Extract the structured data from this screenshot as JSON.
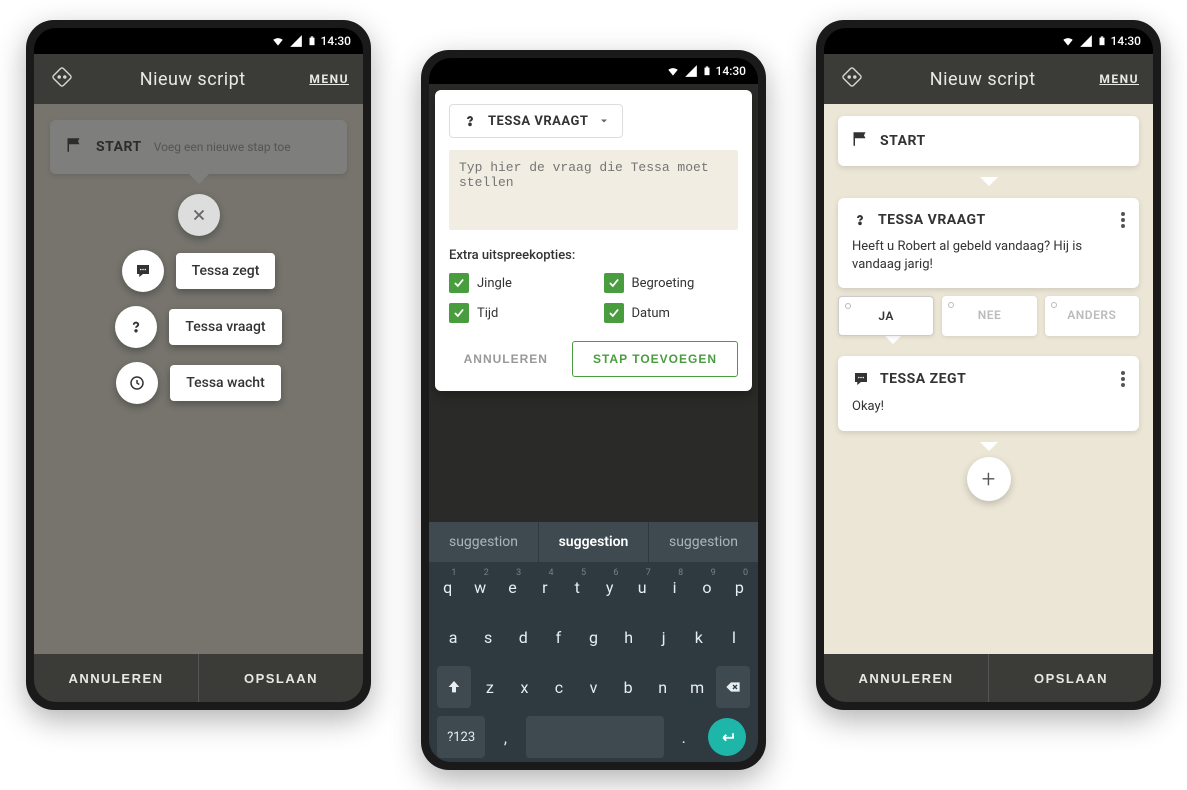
{
  "status": {
    "time": "14:30"
  },
  "appbar": {
    "title": "Nieuw script",
    "menu": "MENU"
  },
  "footer": {
    "cancel": "ANNULEREN",
    "save": "OPSLAAN"
  },
  "phone1": {
    "start_label": "START",
    "start_hint": "Voeg een nieuwe stap toe",
    "actions": [
      {
        "label": "Tessa zegt"
      },
      {
        "label": "Tessa vraagt"
      },
      {
        "label": "Tessa wacht"
      }
    ]
  },
  "phone2": {
    "dropdown": "TESSA VRAAGT",
    "placeholder": "Typ hier de vraag die Tessa moet stellen",
    "extra_label": "Extra uitspreekopties:",
    "opts": [
      "Jingle",
      "Begroeting",
      "Tijd",
      "Datum"
    ],
    "cancel": "ANNULEREN",
    "add": "STAP TOEVOEGEN",
    "suggestions": [
      "suggestion",
      "suggestion",
      "suggestion"
    ],
    "keyboard": {
      "row1": [
        [
          "q",
          "1"
        ],
        [
          "w",
          "2"
        ],
        [
          "e",
          "3"
        ],
        [
          "r",
          "4"
        ],
        [
          "t",
          "5"
        ],
        [
          "y",
          "6"
        ],
        [
          "u",
          "7"
        ],
        [
          "i",
          "8"
        ],
        [
          "o",
          "9"
        ],
        [
          "p",
          "0"
        ]
      ],
      "row2": [
        "a",
        "s",
        "d",
        "f",
        "g",
        "h",
        "j",
        "k",
        "l"
      ],
      "row3": [
        "z",
        "x",
        "c",
        "v",
        "b",
        "n",
        "m"
      ],
      "sym": "?123"
    }
  },
  "phone3": {
    "start_label": "START",
    "q_title": "TESSA VRAAGT",
    "q_body": "Heeft u Robert al gebeld vandaag? Hij is vandaag jarig!",
    "answers": [
      "JA",
      "NEE",
      "ANDERS"
    ],
    "s_title": "TESSA ZEGT",
    "s_body": "Okay!"
  }
}
